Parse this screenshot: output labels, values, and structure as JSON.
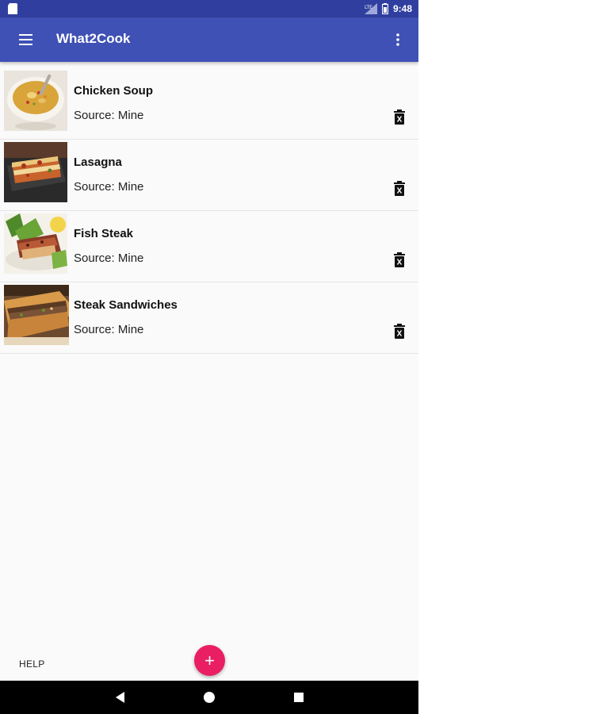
{
  "status_bar": {
    "time": "9:48",
    "icons": [
      "sd-card-icon",
      "signal-icon",
      "battery-icon"
    ]
  },
  "app_bar": {
    "title": "What2Cook",
    "menu_icon": "hamburger-menu-icon",
    "overflow_icon": "more-vert-icon"
  },
  "recipes": [
    {
      "name": "Chicken Soup",
      "source": "Source: Mine",
      "image": "chicken-soup-photo"
    },
    {
      "name": "Lasagna",
      "source": "Source: Mine",
      "image": "lasagna-photo"
    },
    {
      "name": "Fish Steak",
      "source": "Source: Mine",
      "image": "fish-steak-photo"
    },
    {
      "name": "Steak Sandwiches",
      "source": "Source: Mine",
      "image": "steak-sandwich-photo"
    }
  ],
  "footer": {
    "help_label": "HELP",
    "fab_label": "+"
  },
  "colors": {
    "status_bar": "#303f9f",
    "app_bar": "#3f51b5",
    "fab": "#e91e63",
    "nav_bar": "#000000"
  }
}
